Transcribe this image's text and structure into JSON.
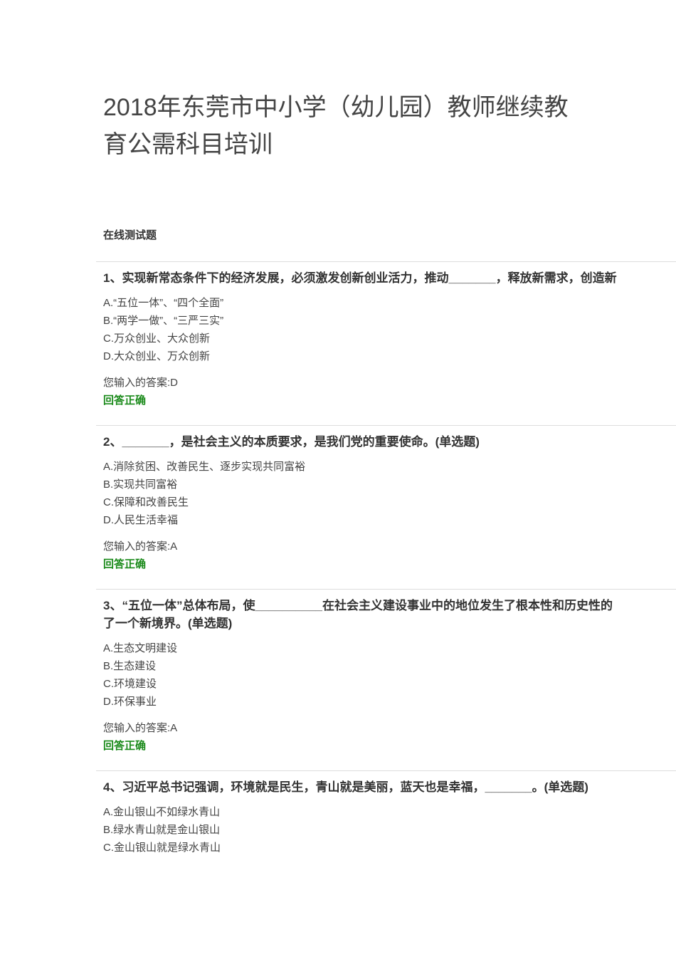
{
  "title_line1": "2018年东莞市中小学（幼儿园）教师继续教",
  "title_line2": "育公需科目培训",
  "section": "在线测试题",
  "questions": [
    {
      "lines": [
        "1、实现新常态条件下的经济发展，必须激发创新创业活力，推动_______，释放新需求，创造新"
      ],
      "options": [
        "A.“五位一体”、“四个全面”",
        "B.“两学一做”、“三严三实”",
        "C.万众创业、大众创新",
        "D.大众创业、万众创新"
      ],
      "answer": "您输入的答案:D",
      "result": "回答正确"
    },
    {
      "lines": [
        "2、_______，是社会主义的本质要求，是我们党的重要使命。(单选题)"
      ],
      "options": [
        "A.消除贫困、改善民生、逐步实现共同富裕",
        "B.实现共同富裕",
        "C.保障和改善民生",
        "D.人民生活幸福"
      ],
      "answer": "您输入的答案:A",
      "result": "回答正确"
    },
    {
      "lines": [
        "3、“五位一体”总体布局，使__________在社会主义建设事业中的地位发生了根本性和历史性的",
        "了一个新境界。(单选题)"
      ],
      "options": [
        "A.生态文明建设",
        "B.生态建设",
        "C.环境建设",
        "D.环保事业"
      ],
      "answer": "您输入的答案:A",
      "result": "回答正确"
    },
    {
      "lines": [
        "4、习近平总书记强调，环境就是民生，青山就是美丽，蓝天也是幸福，_______。(单选题)"
      ],
      "options": [
        "A.金山银山不如绿水青山",
        "B.绿水青山就是金山银山",
        "C.金山银山就是绿水青山"
      ]
    }
  ]
}
